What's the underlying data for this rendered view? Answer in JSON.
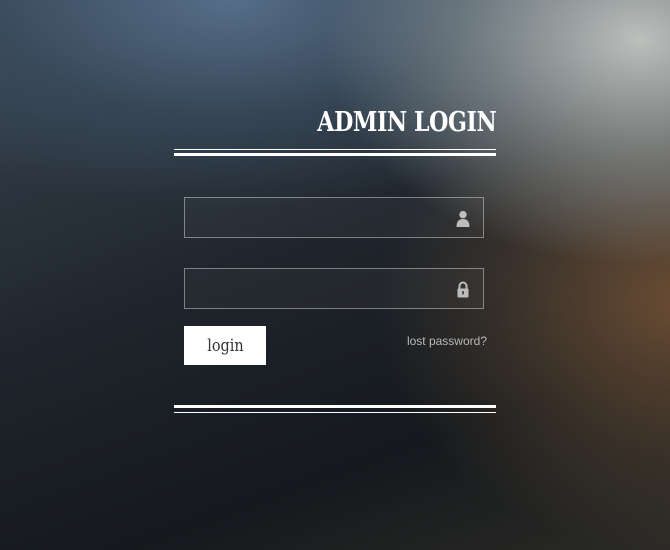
{
  "login_form": {
    "title": "ADMIN LOGIN",
    "username": {
      "value": "",
      "placeholder": "",
      "icon": "user-icon"
    },
    "password": {
      "value": "",
      "placeholder": "",
      "icon": "lock-icon"
    },
    "login_label": "login",
    "lost_password_label": "lost password?"
  },
  "colors": {
    "title": "#ffffff",
    "button_bg": "#ffffff",
    "button_text": "#333333",
    "link": "#b8b8b8",
    "icon": "#bdbdbd",
    "field_border": "#8a8a8a"
  }
}
